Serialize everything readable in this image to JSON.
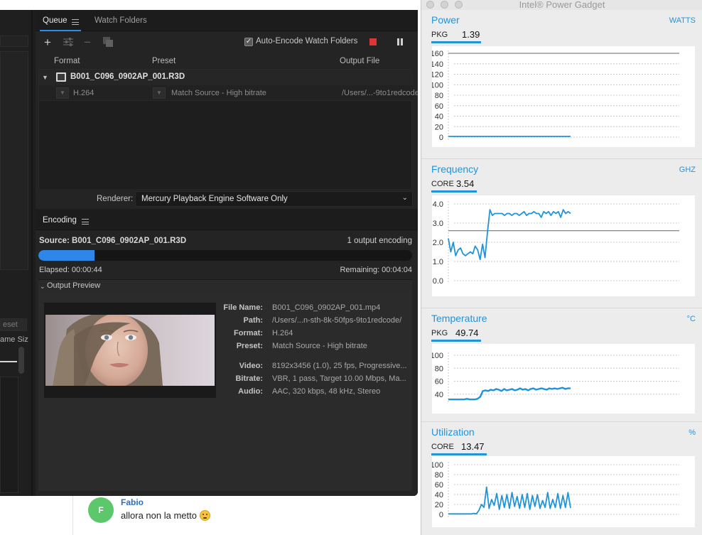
{
  "chat": {
    "avatar_initial": "F",
    "sender": "Fabio",
    "message": "allora non la metto"
  },
  "left_strip": {
    "reset_fragment": "eset",
    "size_fragment": "ame Siz"
  },
  "queue": {
    "tabs": [
      {
        "label": "Queue",
        "active": true
      },
      {
        "label": "Watch Folders",
        "active": false
      }
    ],
    "toolbar_icons": [
      "add-icon",
      "settings-icon",
      "remove-icon",
      "duplicate-icon"
    ],
    "auto_encode_label": "Auto-Encode Watch Folders",
    "auto_encode_checked": true,
    "columns": [
      "Format",
      "Preset",
      "Output File"
    ],
    "item": {
      "file": "B001_C096_0902AP_001.R3D",
      "format": "H.264",
      "preset": "Match Source - High bitrate",
      "output": "/Users/...-9to1redcode"
    },
    "renderer_label": "Renderer:",
    "renderer_value": "Mercury Playback Engine Software Only"
  },
  "encoding": {
    "tab_label": "Encoding",
    "source": "Source: B001_C096_0902AP_001.R3D",
    "output_count": "1 output encoding",
    "progress_fraction": 0.15,
    "elapsed": "Elapsed: 00:00:44",
    "remaining": "Remaining: 00:04:04",
    "output_preview_label": "Output Preview",
    "meta": [
      {
        "key": "File Name:",
        "value": "B001_C096_0902AP_001.mp4"
      },
      {
        "key": "Path:",
        "value": "/Users/...n-sth-8k-50fps-9to1redcode/"
      },
      {
        "key": "Format:",
        "value": "H.264"
      },
      {
        "key": "Preset:",
        "value": "Match Source - High bitrate"
      },
      {
        "key": "Video:",
        "value": "8192x3456 (1.0), 25 fps, Progressive..."
      },
      {
        "key": "Bitrate:",
        "value": "VBR, 1 pass, Target 10.00 Mbps, Ma..."
      },
      {
        "key": "Audio:",
        "value": "AAC, 320 kbps, 48 kHz, Stereo"
      }
    ]
  },
  "gadget": {
    "title": "Intel® Power Gadget",
    "accent_color": "#2194d9",
    "sections": [
      {
        "title": "Power",
        "unit": "WATTS",
        "tag": "PKG",
        "value": "1.39",
        "chart_data": {
          "type": "line",
          "yticks": [
            0,
            20,
            40,
            60,
            80,
            100,
            120,
            140,
            160
          ],
          "ylim": [
            0,
            160
          ],
          "reference_line": 160,
          "series": [
            {
              "values": [
                1.4,
                1.4,
                1.4,
                1.4,
                1.4,
                1.4,
                1.4,
                1.4,
                1.4,
                1.4
              ]
            }
          ]
        }
      },
      {
        "title": "Frequency",
        "unit": "GHZ",
        "tag": "CORE",
        "value": "3.54",
        "chart_data": {
          "type": "line",
          "yticks": [
            0.0,
            1.0,
            2.0,
            3.0,
            4.0
          ],
          "ylim": [
            0,
            4
          ],
          "reference_line": 2.6,
          "series": [
            {
              "values": [
                2.2,
                1.5,
                2.0,
                1.3,
                1.6,
                1.7,
                1.4,
                1.3,
                1.4,
                1.5,
                1.4,
                1.8,
                1.6,
                1.1,
                1.9,
                1.2,
                2.5,
                3.7,
                3.4,
                3.5,
                3.5,
                3.5,
                3.5,
                3.4,
                3.5,
                3.5,
                3.4,
                3.5,
                3.5,
                3.4,
                3.5,
                3.6,
                3.4,
                3.5,
                3.5,
                3.6,
                3.5,
                3.5,
                3.3,
                3.6,
                3.5,
                3.6,
                3.4,
                3.6,
                3.5,
                3.6,
                3.3,
                3.7,
                3.5,
                3.6,
                3.5
              ]
            }
          ]
        }
      },
      {
        "title": "Temperature",
        "unit": "°C",
        "tag": "PKG",
        "value": "49.74",
        "chart_data": {
          "type": "line",
          "yticks": [
            40,
            60,
            80,
            100
          ],
          "ylim": [
            30,
            100
          ],
          "series": [
            {
              "values": [
                32,
                32,
                32,
                32,
                32,
                32,
                32,
                33,
                32,
                32,
                32,
                33,
                36,
                45,
                46,
                45,
                47,
                46,
                48,
                47,
                45,
                48,
                46,
                47,
                48,
                46,
                47,
                49,
                47,
                48,
                46,
                48,
                49,
                47,
                48,
                49,
                48,
                47,
                49,
                48,
                49,
                48,
                49,
                50,
                48,
                49,
                49
              ]
            }
          ]
        }
      },
      {
        "title": "Utilization",
        "unit": "%",
        "tag": "CORE",
        "value": "13.47",
        "chart_data": {
          "type": "line",
          "yticks": [
            0,
            20,
            40,
            60,
            80,
            100
          ],
          "ylim": [
            0,
            100
          ],
          "series": [
            {
              "values": [
                1,
                1,
                1,
                1,
                1,
                1,
                1,
                1,
                1,
                1,
                2,
                1,
                8,
                20,
                14,
                55,
                12,
                30,
                18,
                42,
                10,
                38,
                14,
                40,
                12,
                44,
                16,
                36,
                12,
                40,
                14,
                42,
                10,
                38,
                16,
                40,
                12,
                28,
                14,
                44,
                12,
                30,
                14,
                42,
                12,
                38,
                14,
                44,
                13
              ]
            }
          ]
        }
      }
    ]
  }
}
